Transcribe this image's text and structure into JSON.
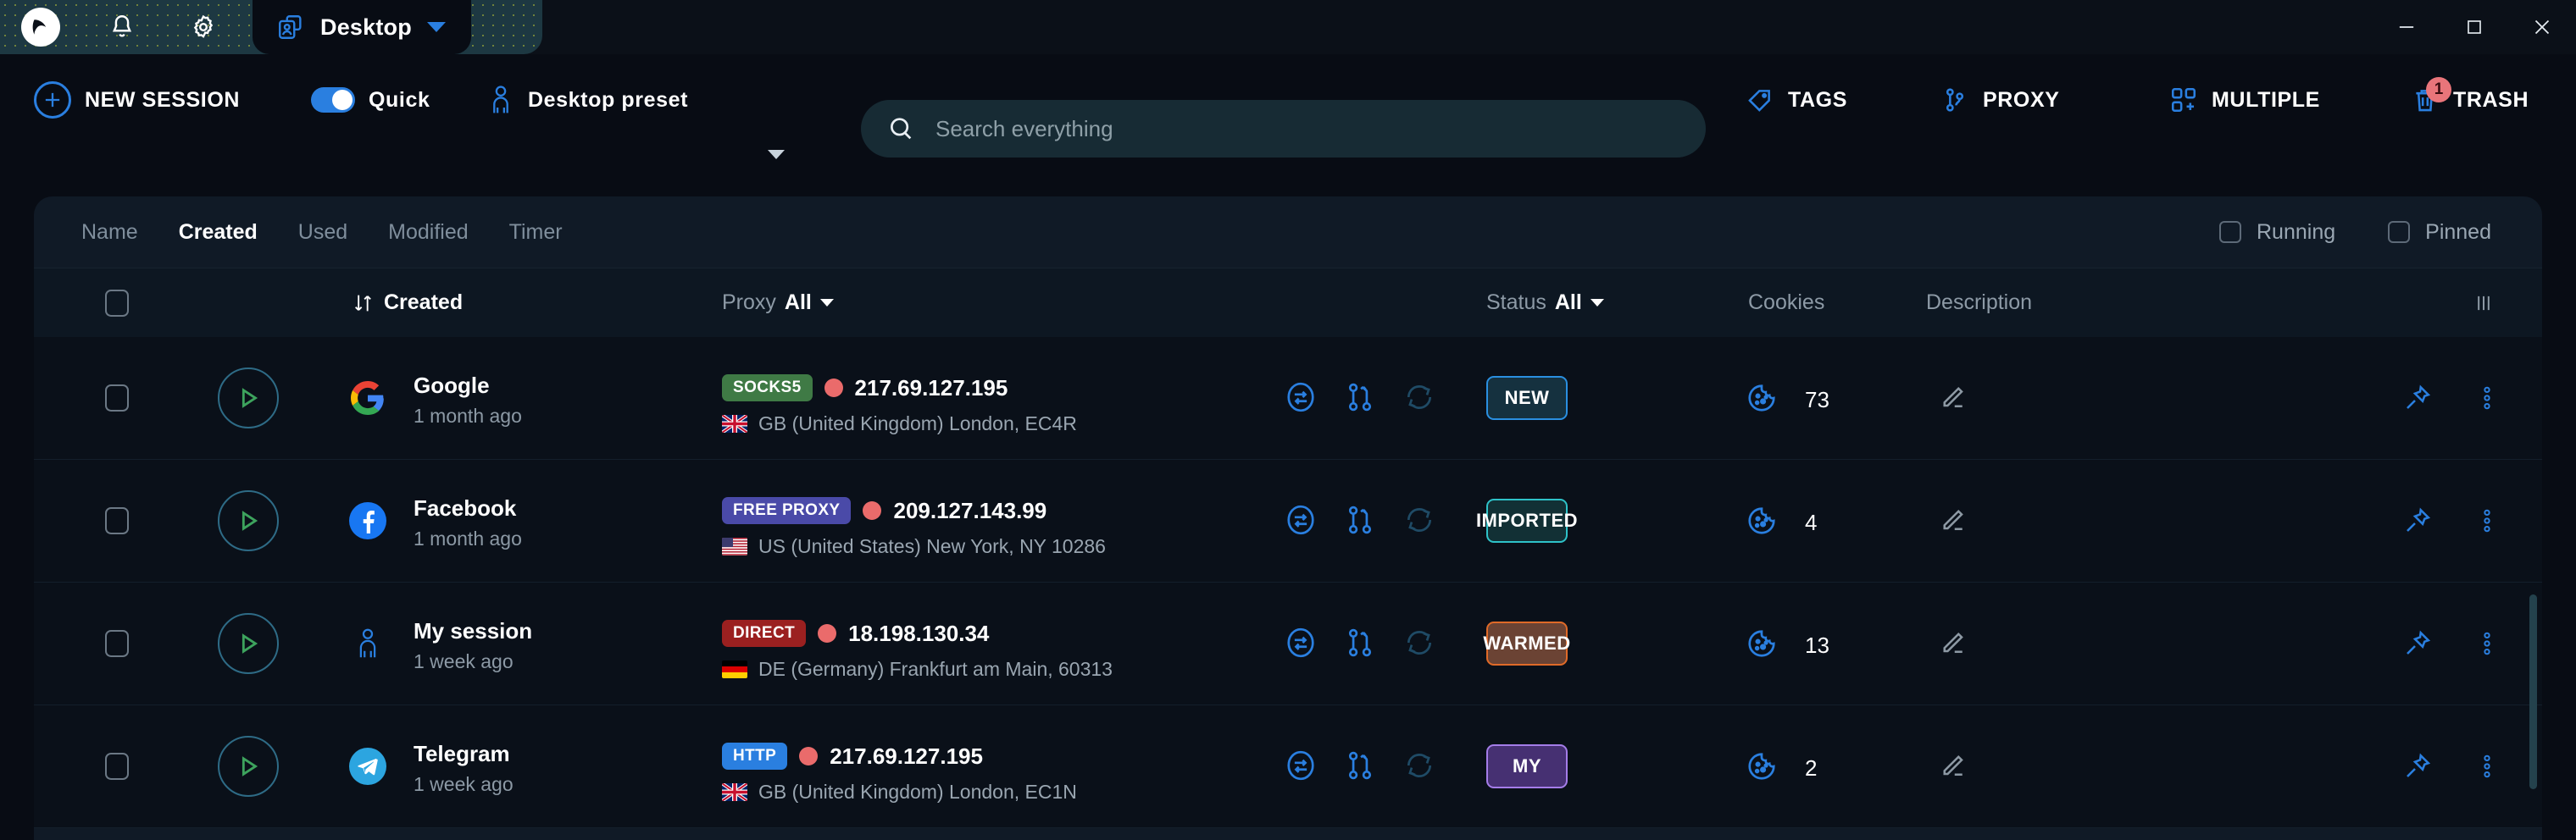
{
  "window": {
    "titlebar_icons": [
      "app-logo-icon",
      "bell-icon",
      "gear-icon"
    ],
    "tab": {
      "label": "Desktop",
      "icon": "profile-cards-icon",
      "caret": "chevron-down-icon"
    },
    "controls": {
      "minimize": "minimize-icon",
      "maximize": "maximize-icon",
      "close": "close-icon"
    }
  },
  "toolbar": {
    "new_session": {
      "label": "NEW SESSION",
      "icon": "plus-circle-icon"
    },
    "quick": {
      "label": "Quick",
      "toggle_on": true
    },
    "preset": {
      "label": "Desktop preset",
      "icon": "person-icon",
      "caret": "chevron-down-icon"
    },
    "search": {
      "placeholder": "Search everything",
      "icon": "search-icon"
    },
    "tags": {
      "label": "TAGS",
      "icon": "tag-icon"
    },
    "proxy": {
      "label": "PROXY",
      "icon": "proxy-node-icon"
    },
    "multiple": {
      "label": "MULTIPLE",
      "icon": "multiple-squares-icon"
    },
    "trash": {
      "label": "TRASH",
      "icon": "trash-icon",
      "badge": "1"
    }
  },
  "subtabs": {
    "items": [
      {
        "label": "Name",
        "active": false
      },
      {
        "label": "Created",
        "active": true
      },
      {
        "label": "Used",
        "active": false
      },
      {
        "label": "Modified",
        "active": false
      },
      {
        "label": "Timer",
        "active": false
      }
    ],
    "filters": [
      {
        "label": "Running",
        "checked": false
      },
      {
        "label": "Pinned",
        "checked": false
      }
    ]
  },
  "table": {
    "headers": {
      "select_all": "select-all-checkbox",
      "created": {
        "sort_icon": "sort-arrows-icon",
        "label": "Created"
      },
      "proxy": {
        "label": "Proxy",
        "value": "All",
        "caret": "chevron-down-icon"
      },
      "status": {
        "label": "Status",
        "value": "All",
        "caret": "chevron-down-icon"
      },
      "cookies": "Cookies",
      "description": "Description",
      "columns_icon": "columns-settings-icon"
    },
    "rows": [
      {
        "name": "Google",
        "date": "1 month ago",
        "avatar": "google-icon",
        "proxy_type": "SOCKS5",
        "proxy_type_color": "#3f7a45",
        "ip": "217.69.127.195",
        "location": "GB (United Kingdom) London, EC4R",
        "flag": "gb",
        "status": "NEW",
        "status_fg": "#ffffff",
        "status_border": "#2a8fe0",
        "status_bg": "#15313f",
        "cookies": "73"
      },
      {
        "name": "Facebook",
        "date": "1 month ago",
        "avatar": "facebook-icon",
        "proxy_type": "FREE PROXY",
        "proxy_type_color": "#4a4aa8",
        "ip": "209.127.143.99",
        "location": "US (United States) New York, NY 10286",
        "flag": "us",
        "status": "IMPORTED",
        "status_fg": "#ffffff",
        "status_border": "#2ec2c8",
        "status_bg": "#123035",
        "cookies": "4"
      },
      {
        "name": "My session",
        "date": "1 week ago",
        "avatar": "person-icon",
        "proxy_type": "DIRECT",
        "proxy_type_color": "#9b2020",
        "ip": "18.198.130.34",
        "location": "DE (Germany) Frankfurt am Main, 60313",
        "flag": "de",
        "status": "WARMED",
        "status_fg": "#ffffff",
        "status_border": "#e06a28",
        "status_bg": "#6b4334",
        "cookies": "13"
      },
      {
        "name": "Telegram",
        "date": "1 week ago",
        "avatar": "telegram-icon",
        "proxy_type": "HTTP",
        "proxy_type_color": "#2a7fe0",
        "ip": "217.69.127.195",
        "location": "GB (United Kingdom) London, EC1N",
        "flag": "gb",
        "status": "MY",
        "status_fg": "#ffffff",
        "status_border": "#a47de8",
        "status_bg": "#463072",
        "cookies": "2"
      }
    ],
    "row_icons": {
      "transfer": "transfer-circle-icon",
      "fingerprint": "branch-icon",
      "refresh": "refresh-icon",
      "edit": "pencil-icon",
      "pin": "pin-icon",
      "more": "more-vertical-icon"
    }
  },
  "colors": {
    "accent": "#2a7fe0",
    "panel_bg": "#101a26",
    "row_bg": "#0a1019",
    "window_bg": "#080c14"
  }
}
